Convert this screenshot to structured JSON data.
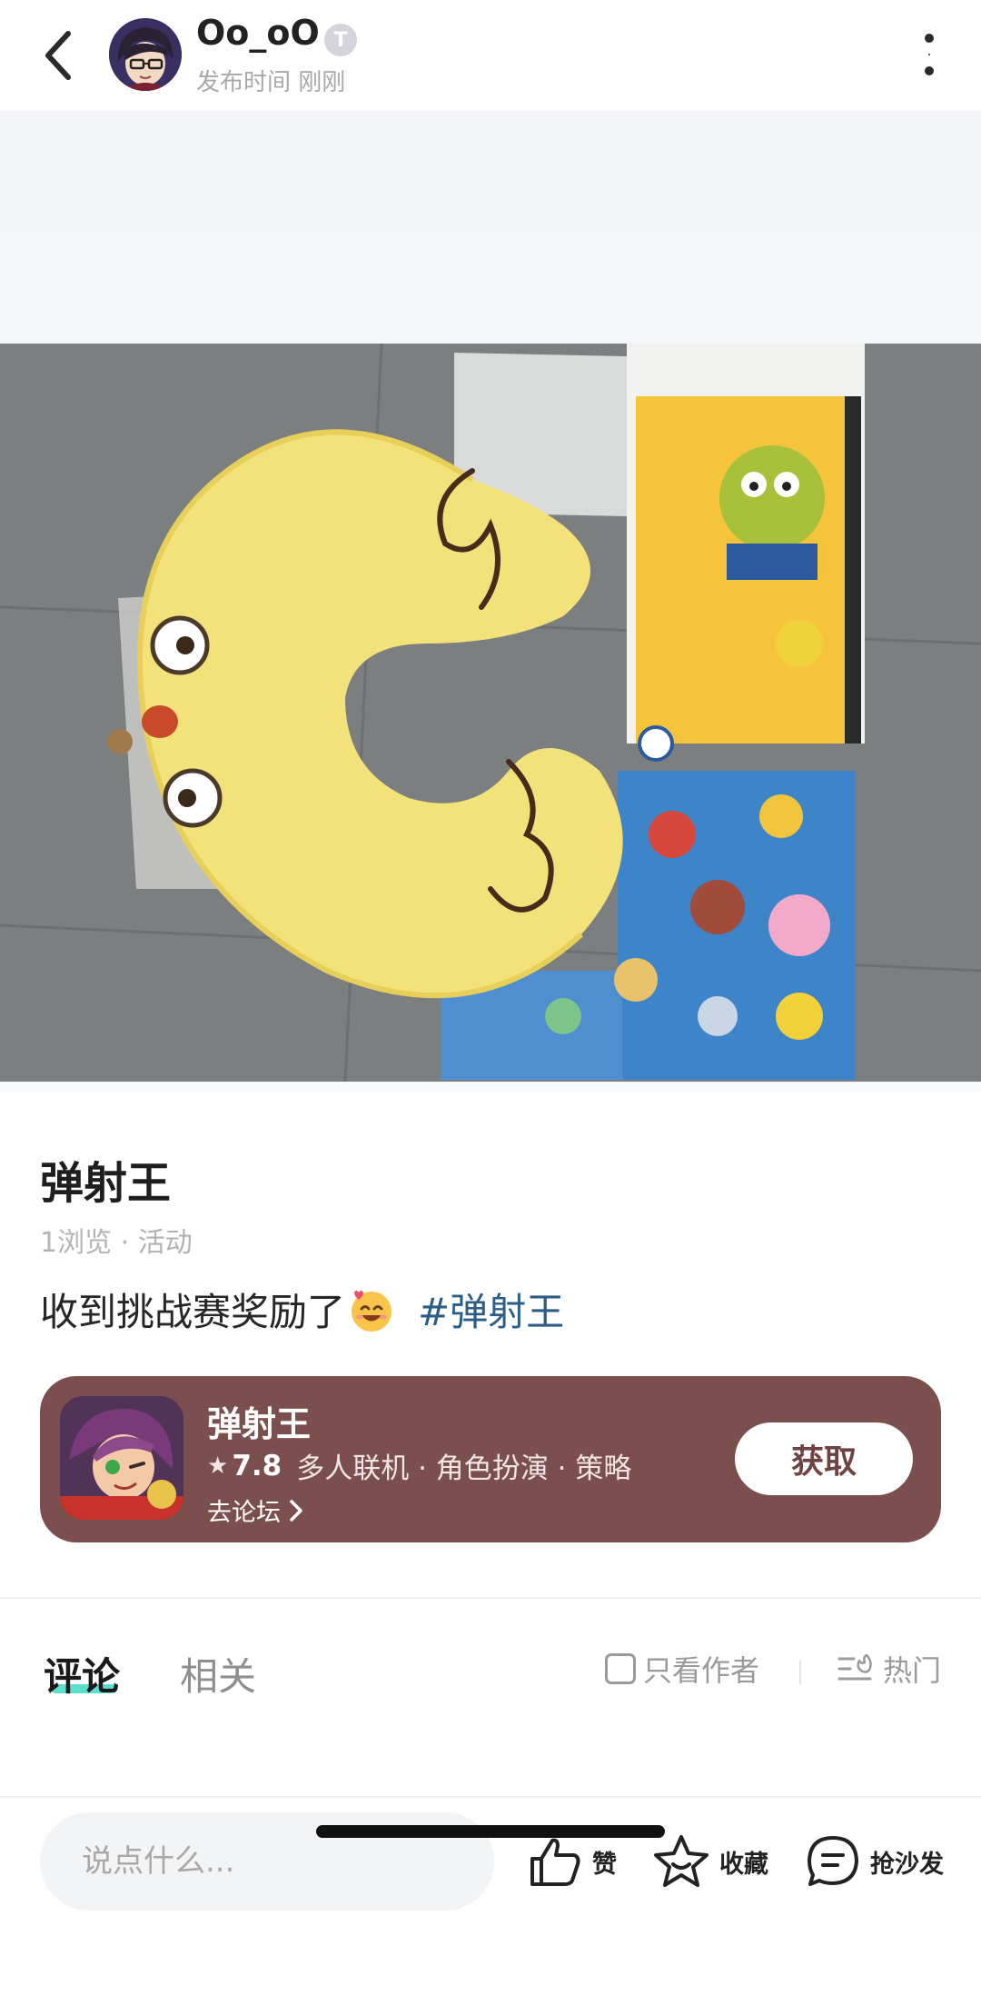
{
  "header": {
    "username": "Oo_oO",
    "verify_badge": "T",
    "post_time": "发布时间 刚刚"
  },
  "post": {
    "title": "弹射王",
    "meta": "1浏览 · 活动",
    "body_text": "收到挑战赛奖励了",
    "hashtag": "#弹射王"
  },
  "game_card": {
    "name": "弹射王",
    "rating": "7.8",
    "tags": "多人联机 · 角色扮演 · 策略",
    "forum_link": "去论坛",
    "get_button": "获取",
    "colors": {
      "background": "#7a4f4d",
      "button_text": "#6e4341"
    }
  },
  "tabs": {
    "comments": "评论",
    "related": "相关",
    "only_author": "只看作者",
    "sort": "热门",
    "accent": "#3fd8c3"
  },
  "bottom_bar": {
    "input_placeholder": "说点什么...",
    "like": "赞",
    "favorite": "收藏",
    "comment": "抢沙发"
  },
  "icons": [
    "back-arrow-icon",
    "more-vertical-icon",
    "chevron-right-icon",
    "star-icon",
    "sort-icon",
    "thumb-up-icon",
    "star-outline-icon",
    "comment-bubble-icon"
  ]
}
